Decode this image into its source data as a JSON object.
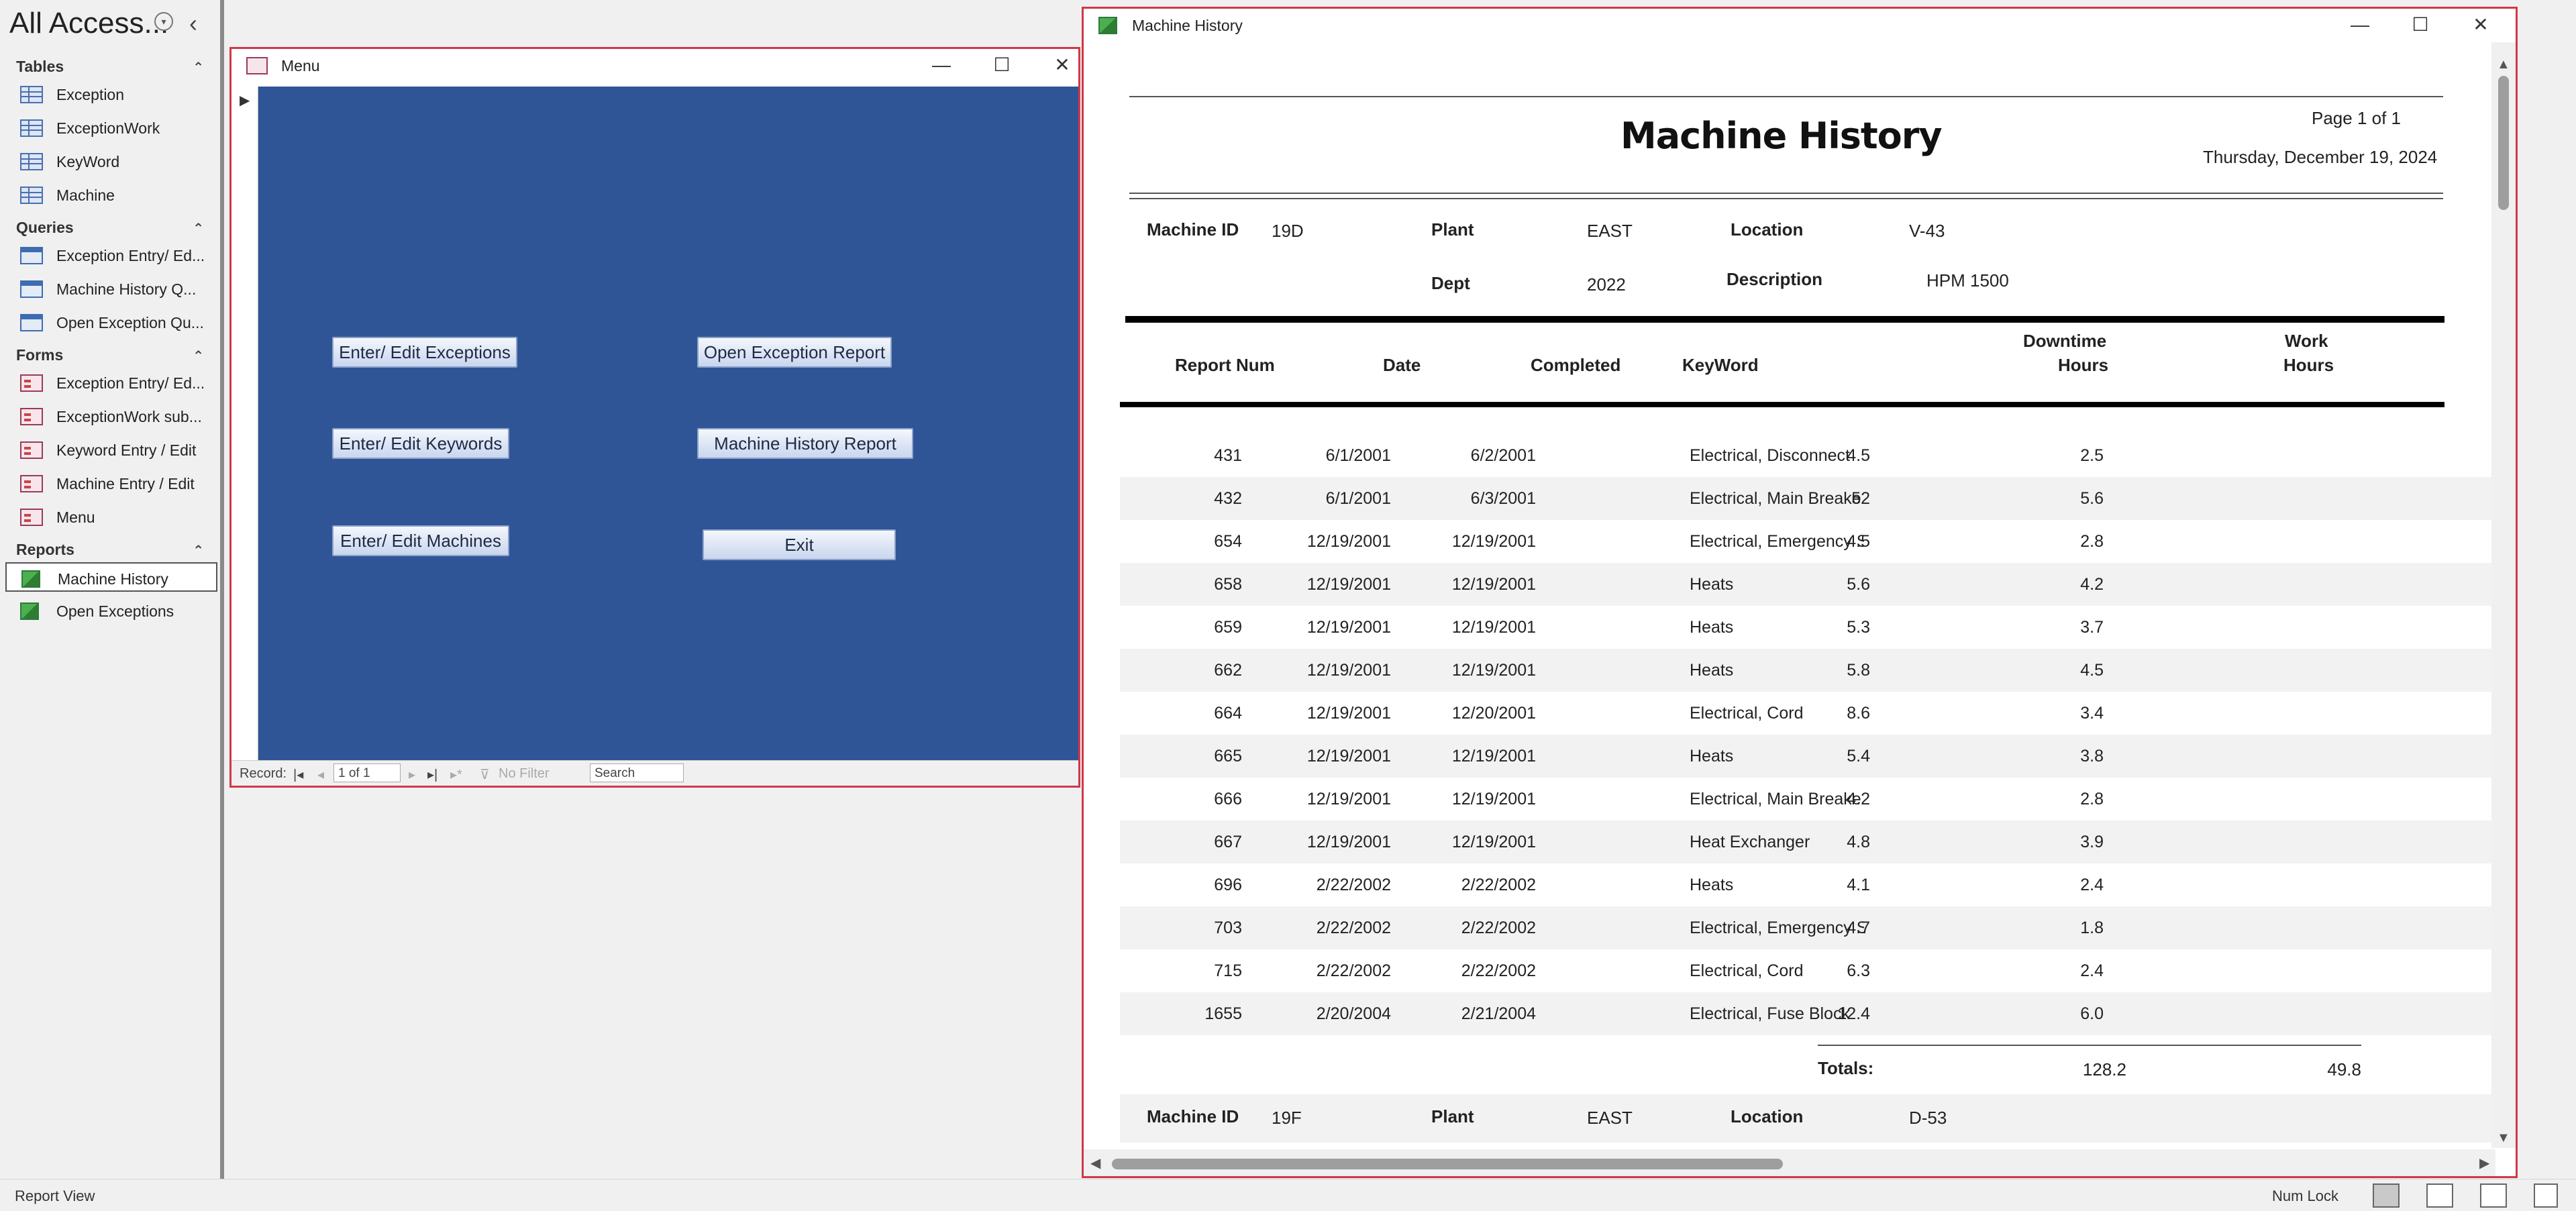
{
  "nav": {
    "title": "All Access...",
    "title_dropdown_icon": "chevron-down-icon",
    "collapse_icon": "chevron-left-icon",
    "groups": [
      {
        "label": "Tables",
        "items": [
          {
            "label": "Exception",
            "icon": "table-icon"
          },
          {
            "label": "ExceptionWork",
            "icon": "table-icon"
          },
          {
            "label": "KeyWord",
            "icon": "table-icon"
          },
          {
            "label": "Machine",
            "icon": "table-icon"
          }
        ]
      },
      {
        "label": "Queries",
        "items": [
          {
            "label": "Exception Entry/ Ed...",
            "icon": "query-icon"
          },
          {
            "label": "Machine History Q...",
            "icon": "query-icon"
          },
          {
            "label": "Open Exception Qu...",
            "icon": "query-icon"
          }
        ]
      },
      {
        "label": "Forms",
        "items": [
          {
            "label": "Exception Entry/ Ed...",
            "icon": "form-icon"
          },
          {
            "label": "ExceptionWork sub...",
            "icon": "form-icon"
          },
          {
            "label": "Keyword Entry / Edit",
            "icon": "form-icon"
          },
          {
            "label": "Machine Entry / Edit",
            "icon": "form-icon"
          },
          {
            "label": "Menu",
            "icon": "form-icon"
          }
        ]
      },
      {
        "label": "Reports",
        "items": [
          {
            "label": "Machine History",
            "icon": "report-icon",
            "selected": true
          },
          {
            "label": "Open Exceptions",
            "icon": "report-icon"
          }
        ]
      }
    ]
  },
  "menu_form": {
    "title": "Menu",
    "buttons": {
      "enter_exceptions": "Enter/ Edit Exceptions",
      "enter_keywords": "Enter/ Edit Keywords",
      "enter_machines": "Enter/ Edit Machines",
      "open_exception_report": "Open Exception Report",
      "machine_history_report": "Machine History Report",
      "exit": "Exit"
    },
    "record_nav": {
      "label": "Record:",
      "position": "1 of 1",
      "filter": "No Filter",
      "search_placeholder": "Search"
    }
  },
  "report": {
    "window_title": "Machine History",
    "title": "Machine History",
    "page": "Page 1 of 1",
    "date": "Thursday, December 19, 2024",
    "header": {
      "machine_id_label": "Machine ID",
      "machine_id": "19D",
      "plant_label": "Plant",
      "plant": "EAST",
      "location_label": "Location",
      "location": "V-43",
      "dept_label": "Dept",
      "dept": "2022",
      "description_label": "Description",
      "description": "HPM 1500"
    },
    "columns": {
      "report_num": "Report Num",
      "date": "Date",
      "completed": "Completed",
      "keyword": "KeyWord",
      "downtime_1": "Downtime",
      "downtime_2": "Hours",
      "work_1": "Work",
      "work_2": "Hours"
    },
    "rows": [
      {
        "num": "431",
        "date": "6/1/2001",
        "completed": "6/2/2001",
        "keyword": "Electrical, Disconnect",
        "downtime": "4.5",
        "work": "2.5"
      },
      {
        "num": "432",
        "date": "6/1/2001",
        "completed": "6/3/2001",
        "keyword": "Electrical, Main Breake",
        "downtime": "52",
        "work": "5.6"
      },
      {
        "num": "654",
        "date": "12/19/2001",
        "completed": "12/19/2001",
        "keyword": "Electrical, Emergency S",
        "downtime": "4.5",
        "work": "2.8"
      },
      {
        "num": "658",
        "date": "12/19/2001",
        "completed": "12/19/2001",
        "keyword": "Heats",
        "downtime": "5.6",
        "work": "4.2"
      },
      {
        "num": "659",
        "date": "12/19/2001",
        "completed": "12/19/2001",
        "keyword": "Heats",
        "downtime": "5.3",
        "work": "3.7"
      },
      {
        "num": "662",
        "date": "12/19/2001",
        "completed": "12/19/2001",
        "keyword": "Heats",
        "downtime": "5.8",
        "work": "4.5"
      },
      {
        "num": "664",
        "date": "12/19/2001",
        "completed": "12/20/2001",
        "keyword": "Electrical, Cord",
        "downtime": "8.6",
        "work": "3.4"
      },
      {
        "num": "665",
        "date": "12/19/2001",
        "completed": "12/19/2001",
        "keyword": "Heats",
        "downtime": "5.4",
        "work": "3.8"
      },
      {
        "num": "666",
        "date": "12/19/2001",
        "completed": "12/19/2001",
        "keyword": "Electrical, Main Breake",
        "downtime": "4.2",
        "work": "2.8"
      },
      {
        "num": "667",
        "date": "12/19/2001",
        "completed": "12/19/2001",
        "keyword": "Heat Exchanger",
        "downtime": "4.8",
        "work": "3.9"
      },
      {
        "num": "696",
        "date": "2/22/2002",
        "completed": "2/22/2002",
        "keyword": "Heats",
        "downtime": "4.1",
        "work": "2.4"
      },
      {
        "num": "703",
        "date": "2/22/2002",
        "completed": "2/22/2002",
        "keyword": "Electrical, Emergency S",
        "downtime": "4.7",
        "work": "1.8"
      },
      {
        "num": "715",
        "date": "2/22/2002",
        "completed": "2/22/2002",
        "keyword": "Electrical, Cord",
        "downtime": "6.3",
        "work": "2.4"
      },
      {
        "num": "1655",
        "date": "2/20/2004",
        "completed": "2/21/2004",
        "keyword": "Electrical, Fuse Block",
        "downtime": "12.4",
        "work": "6.0"
      }
    ],
    "totals": {
      "label": "Totals:",
      "downtime": "128.2",
      "work": "49.8"
    },
    "next_header": {
      "machine_id_label": "Machine ID",
      "machine_id": "19F",
      "plant_label": "Plant",
      "plant": "EAST",
      "location_label": "Location",
      "location": "D-53"
    }
  },
  "statusbar": {
    "view": "Report View",
    "num_lock": "Num Lock"
  }
}
